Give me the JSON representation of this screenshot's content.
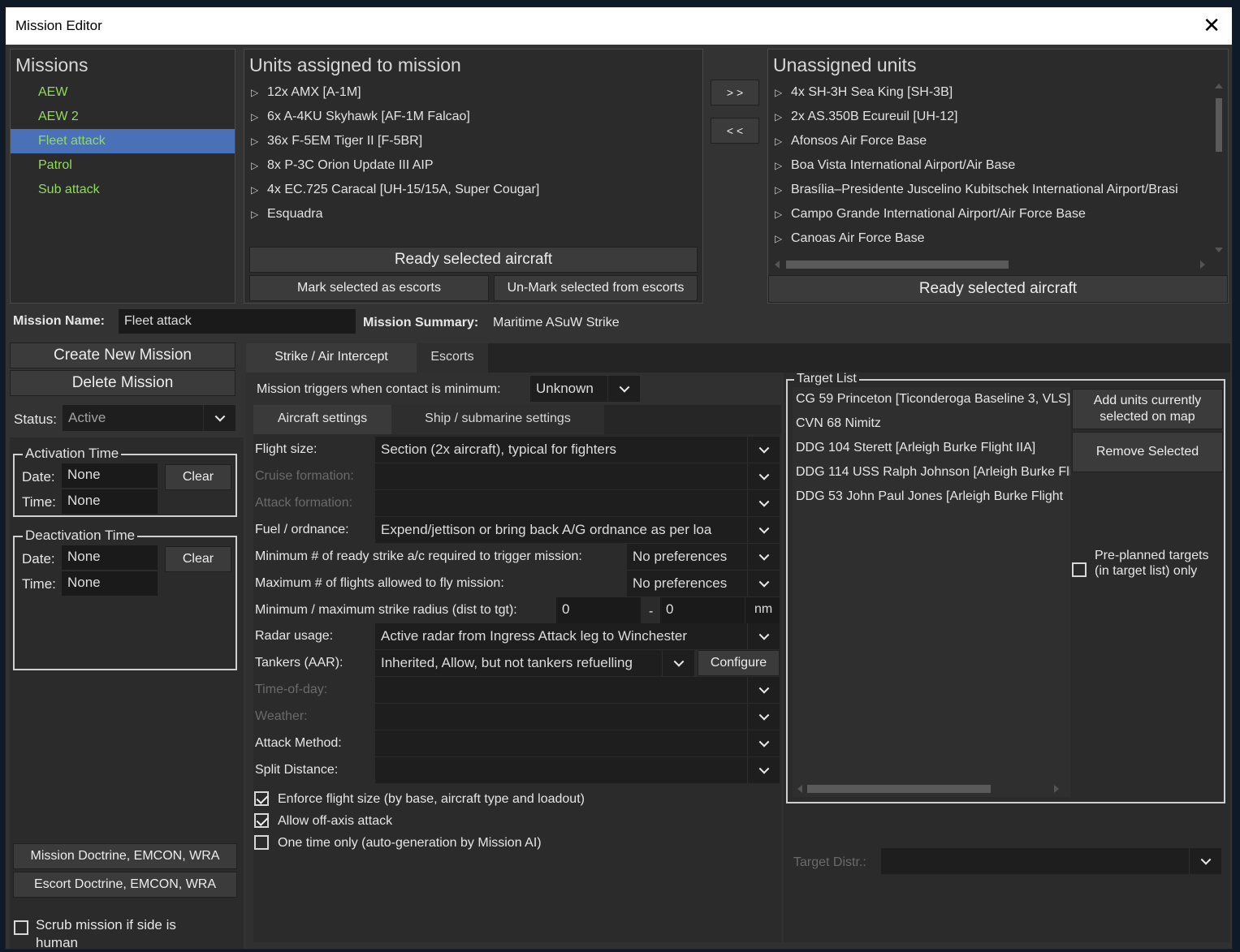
{
  "window": {
    "title": "Mission Editor"
  },
  "missions": {
    "header": "Missions",
    "items": [
      "AEW",
      "AEW 2",
      "Fleet attack",
      "Patrol",
      "Sub attack"
    ],
    "selected_index": 2
  },
  "assigned": {
    "header": "Units assigned to mission",
    "items": [
      "12x AMX [A-1M]",
      "6x A-4KU Skyhawk [AF-1M Falcao]",
      "36x F-5EM Tiger II [F-5BR]",
      "8x P-3C Orion Update III AIP",
      "4x EC.725 Caracal [UH-15/15A, Super Cougar]",
      "Esquadra"
    ],
    "ready_button": "Ready selected aircraft",
    "mark_escort_button": "Mark selected as escorts",
    "unmark_escort_button": "Un-Mark selected from escorts"
  },
  "transfer": {
    "assign": "> >",
    "unassign": "< <"
  },
  "unassigned": {
    "header": "Unassigned units",
    "items": [
      "4x SH-3H Sea King [SH-3B]",
      "2x AS.350B Ecureuil [UH-12]",
      "Afonsos Air Force Base",
      "Boa Vista International Airport/Air Base",
      "Brasília–Presidente Juscelino Kubitschek International Airport/Brasi",
      "Campo Grande International Airport/Air Force Base",
      "Canoas Air Force Base"
    ],
    "ready_button": "Ready selected aircraft"
  },
  "mission_name": {
    "label": "Mission Name:",
    "value": "Fleet attack"
  },
  "mission_summary": {
    "label": "Mission Summary:",
    "value": "Maritime ASuW Strike"
  },
  "actions": {
    "create": "Create New Mission",
    "delete": "Delete Mission"
  },
  "status": {
    "label": "Status:",
    "value": "Active"
  },
  "activation": {
    "title": "Activation Time",
    "date_label": "Date:",
    "date_value": "None",
    "time_label": "Time:",
    "time_value": "None",
    "clear": "Clear"
  },
  "deactivation": {
    "title": "Deactivation Time",
    "date_label": "Date:",
    "date_value": "None",
    "time_label": "Time:",
    "time_value": "None",
    "clear": "Clear"
  },
  "doctrine": {
    "mission": "Mission Doctrine, EMCON, WRA",
    "escort": "Escort Doctrine, EMCON, WRA"
  },
  "scrub": {
    "label": "Scrub mission if side is human",
    "checked": false
  },
  "tabs": {
    "strike": "Strike / Air Intercept",
    "escorts": "Escorts"
  },
  "trigger": {
    "label": "Mission triggers when contact is minimum:",
    "value": "Unknown"
  },
  "subtabs": {
    "aircraft": "Aircraft settings",
    "ship": "Ship / submarine settings"
  },
  "settings": {
    "flight_size": {
      "label": "Flight size:",
      "value": "Section (2x aircraft), typical for fighters"
    },
    "cruise_formation": {
      "label": "Cruise formation:",
      "value": ""
    },
    "attack_formation": {
      "label": "Attack formation:",
      "value": ""
    },
    "fuel": {
      "label": "Fuel / ordnance:",
      "value": "Expend/jettison or bring back A/G ordnance as per loa"
    },
    "min_ready": {
      "label": "Minimum # of ready strike a/c required to trigger mission:",
      "value": "No preferences"
    },
    "max_flights": {
      "label": "Maximum # of flights allowed to fly mission:",
      "value": "No preferences"
    },
    "radius": {
      "label": "Minimum / maximum strike radius (dist to tgt):",
      "min": "0",
      "sep": "-",
      "max": "0",
      "unit": "nm"
    },
    "radar": {
      "label": "Radar usage:",
      "value": "Active radar from Ingress Attack leg to Winchester"
    },
    "tankers": {
      "label": "Tankers (AAR):",
      "value": "Inherited, Allow, but not tankers refuelling",
      "configure": "Configure"
    },
    "time_of_day": {
      "label": "Time-of-day:",
      "value": ""
    },
    "weather": {
      "label": "Weather:",
      "value": ""
    },
    "attack_method": {
      "label": "Attack Method:",
      "value": ""
    },
    "split_distance": {
      "label": "Split Distance:",
      "value": ""
    }
  },
  "checks": {
    "enforce": {
      "label": "Enforce flight size (by base, aircraft type and loadout)",
      "checked": true
    },
    "offaxis": {
      "label": "Allow off-axis attack",
      "checked": true
    },
    "onetime": {
      "label": "One time only (auto-generation by Mission AI)",
      "checked": false
    }
  },
  "target_list": {
    "title": "Target List",
    "items": [
      "CG 59 Princeton [Ticonderoga Baseline 3, VLS]",
      "CVN 68 Nimitz",
      "DDG 104 Sterett [Arleigh Burke Flight IIA]",
      "DDG 114 USS Ralph Johnson [Arleigh Burke Fli",
      "DDG 53 John Paul Jones [Arleigh Burke Flight"
    ],
    "add_button": "Add units currently selected on map",
    "remove_button": "Remove Selected",
    "preplanned": "Pre-planned targets (in target list) only",
    "preplanned_checked": false
  },
  "target_distr": {
    "label": "Target Distr.:",
    "value": ""
  }
}
